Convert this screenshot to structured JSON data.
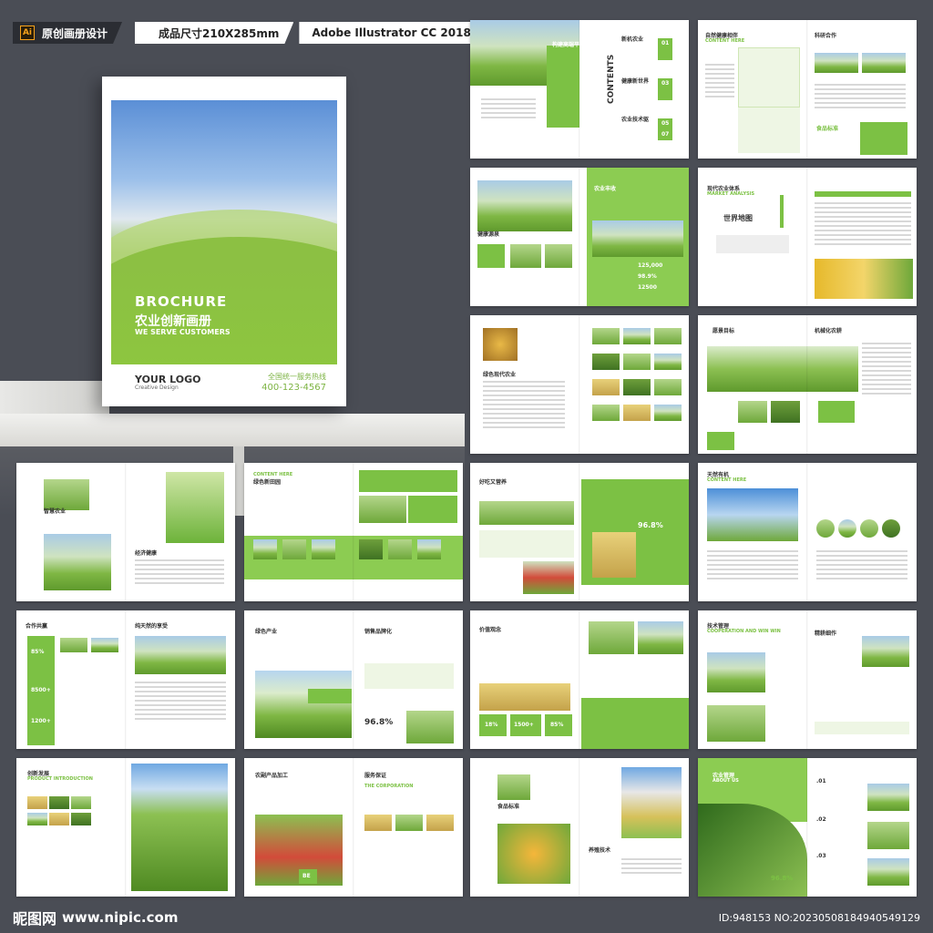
{
  "header": {
    "badge1": "原创画册设计",
    "badge1_icon": "Ai",
    "badge2": "成品尺寸210X285mm",
    "badge3": "Adobe Illustrator CC 2018"
  },
  "cover": {
    "title": "BROCHURE",
    "subtitle": "农业创新画册",
    "subtitle_en": "WE SERVE CUSTOMERS",
    "logo": "YOUR LOGO",
    "logo_sub": "Creative Design",
    "hotline_label": "全国统一服务热线",
    "phone": "400-123-4567"
  },
  "spreads": {
    "s1": {
      "title": "构建高端平台",
      "contents": "CONTENTS",
      "toc1": "新机农业",
      "toc2": "健康新世界",
      "toc3": "农业技术驱",
      "n1": "01",
      "n2": "03",
      "n3": "05",
      "n4": "07"
    },
    "s2": {
      "title": "自然健康相伴",
      "right": "科研合作",
      "en": "CONTENT HERE",
      "quote": "食品标准"
    },
    "s3": {
      "left": "健康源泉",
      "right": "农业丰收",
      "n1": "125,000",
      "n2": "98.9%",
      "n3": "12500"
    },
    "s4": {
      "title": "现代农业体系",
      "sub": "世界地图",
      "en": "MARKET ANALYSIS"
    },
    "s5": {
      "left": "绿色现代农业"
    },
    "s6": {
      "left": "愿景目标",
      "right": "机械化农耕"
    },
    "s7": {
      "left": "智慧农业",
      "right": "经济健康"
    },
    "s8": {
      "title": "绿色新田园",
      "en": "CONTENT HERE"
    },
    "s9": {
      "title": "好吃又营养",
      "n1": "96.8%"
    },
    "s10": {
      "title": "天然有机",
      "en": "CONTENT HERE"
    },
    "s11": {
      "left": "合作共赢",
      "right": "纯天然的享受",
      "n1": "85%",
      "n2": "8500+",
      "n3": "1200+"
    },
    "s12": {
      "left": "绿色产业",
      "right": "销售品牌化",
      "n1": "96.8%"
    },
    "s13": {
      "title": "价值观念",
      "n1": "18%",
      "n2": "1500+",
      "n3": "85%"
    },
    "s14": {
      "left": "技术管理",
      "right": "精耕细作",
      "en": "COOPERATION AND WIN WIN"
    },
    "s15": {
      "title": "创新发展",
      "en": "PRODUCT INTRODUCTION"
    },
    "s16": {
      "left": "农副产品加工",
      "right": "服务保证",
      "en": "THE CORPORATION",
      "tag": "BE"
    },
    "s17": {
      "left": "食品标准",
      "right": "养殖技术"
    },
    "s18": {
      "title": "农业管理",
      "en": "ABOUT US",
      "n1": ".01",
      "n2": ".02",
      "n3": ".03",
      "n4": "96.8%"
    }
  },
  "footer": {
    "logo": "昵图网",
    "url": "www.nipic.com",
    "id": "ID:948153 NO:20230508184940549129"
  }
}
